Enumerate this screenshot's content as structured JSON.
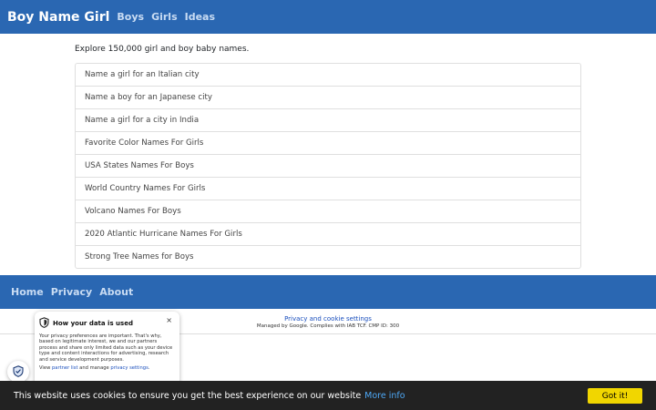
{
  "navbar": {
    "brand": "Boy Name Girl",
    "links": [
      "Boys",
      "Girls",
      "Ideas"
    ]
  },
  "main": {
    "intro": "Explore 150,000 girl and boy baby names.",
    "items": [
      "Name a girl for an Italian city",
      "Name a boy for an Japanese city",
      "Name a girl for a city in India",
      "Favorite Color Names For Girls",
      "USA States Names For Boys",
      "World Country Names For Girls",
      "Volcano Names For Boys",
      "2020 Atlantic Hurricane Names For Girls",
      "Strong Tree Names for Boys"
    ]
  },
  "footer": {
    "links": [
      "Home",
      "Privacy",
      "About"
    ]
  },
  "consent": {
    "settings_link": "Privacy and cookie settings",
    "managed_by": "Managed by Google. Complies with IAB TCF. CMP ID: 300"
  },
  "privacy_popup": {
    "title": "How your data is used",
    "close": "×",
    "body": "Your privacy preferences are important. That's why, based on legitimate interest, we and our partners process and share only limited data such as your device type and content interactions for advertising, research and service development purposes.",
    "view_prefix": "View",
    "partner_link": "partner list",
    "manage_text": "and manage",
    "settings_link": "privacy settings",
    "suffix": "."
  },
  "cookie_bar": {
    "text": "This website uses cookies to ensure you get the best experience on our website",
    "more_link": "More info",
    "button": "Got it!"
  },
  "colors": {
    "navbar": "#2a67b2",
    "cookie_bar": "#222222",
    "cookie_button": "#f1d600",
    "link": "#1a4fbd"
  }
}
